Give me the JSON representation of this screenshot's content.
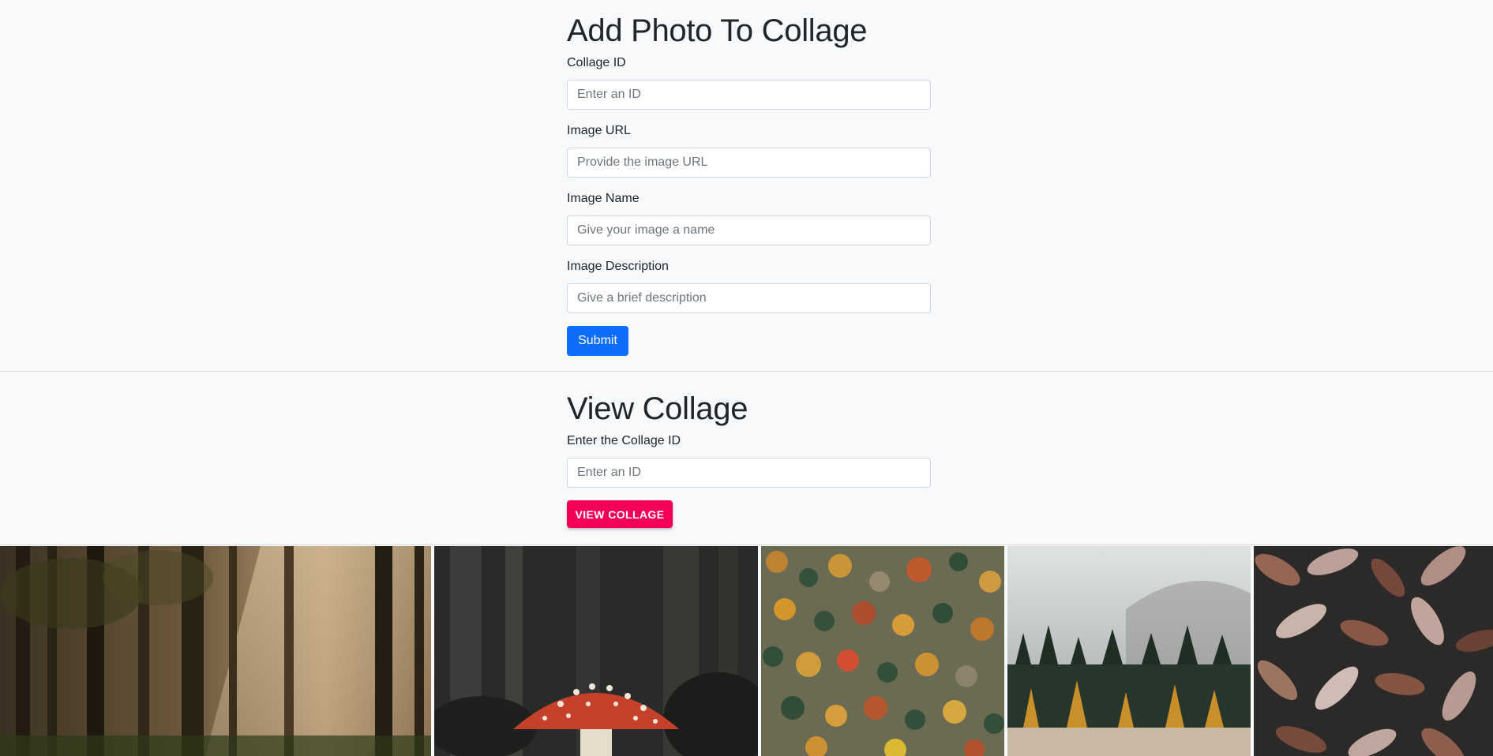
{
  "add_section": {
    "title": "Add Photo To Collage",
    "fields": [
      {
        "label": "Collage ID",
        "placeholder": "Enter an ID"
      },
      {
        "label": "Image URL",
        "placeholder": "Provide the image URL"
      },
      {
        "label": "Image Name",
        "placeholder": "Give your image a name"
      },
      {
        "label": "Image Description",
        "placeholder": "Give a brief description"
      }
    ],
    "submit_label": "Submit"
  },
  "view_section": {
    "title": "View Collage",
    "field": {
      "label": "Enter the Collage ID",
      "placeholder": "Enter an ID"
    },
    "button_label": "VIEW COLLAGE"
  },
  "gallery": {
    "photos": [
      {
        "name": "forest-sunbeams-photo"
      },
      {
        "name": "red-mushroom-photo"
      },
      {
        "name": "autumn-hillside-photo"
      },
      {
        "name": "misty-forest-photo"
      },
      {
        "name": "oak-leaves-photo"
      }
    ]
  },
  "colors": {
    "primary": "#0d6efd",
    "accent": "#f50057",
    "background": "#f8f9fa"
  }
}
